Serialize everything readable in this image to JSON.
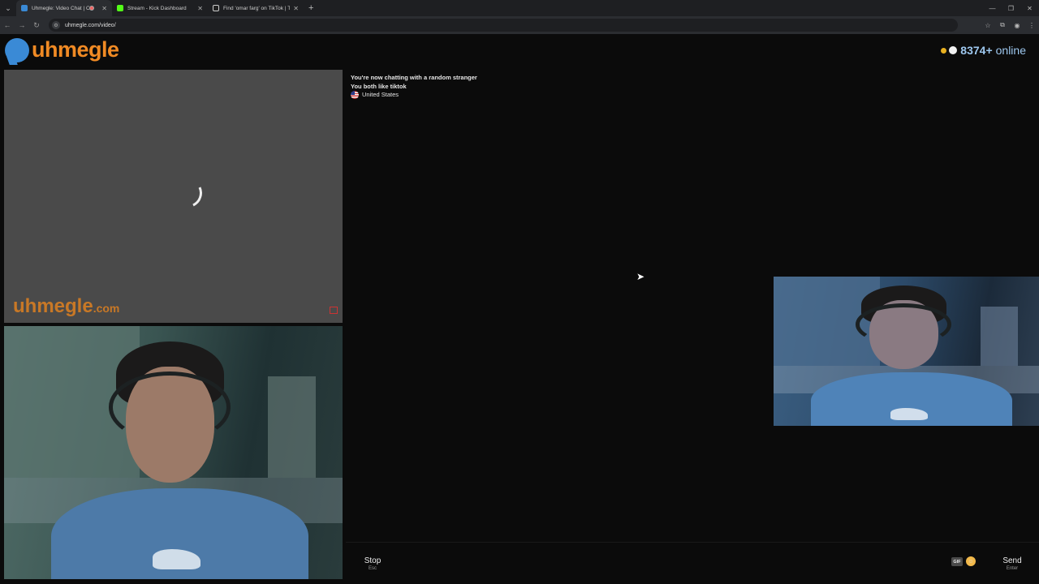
{
  "browser": {
    "tabs": [
      {
        "title": "Uhmegle: Video Chat | Om",
        "active": true,
        "favicon_color": "#3a8ad6",
        "recording": true
      },
      {
        "title": "Stream - Kick Dashboard",
        "active": false,
        "favicon_color": "#53fc18"
      },
      {
        "title": "Find 'omar farg' on TikTok | Ti",
        "active": false,
        "favicon_color": "#e0e0e0"
      }
    ],
    "url": "uhmegle.com/video/"
  },
  "header": {
    "logo_text": "uhmegle",
    "online_count": "8374+",
    "online_label": "online"
  },
  "stranger": {
    "watermark": "uhmegle",
    "watermark_suffix": ".com"
  },
  "chat": {
    "messages": [
      "You're now chatting with a random stranger",
      "You both like tiktok"
    ],
    "country": "United States"
  },
  "controls": {
    "stop_label": "Stop",
    "stop_hint": "Esc",
    "gif_label": "GIF",
    "send_label": "Send",
    "send_hint": "Enter"
  },
  "colors": {
    "brand_orange": "#f08a24",
    "brand_blue": "#3a8ad6",
    "online_text": "#9ec8ef"
  }
}
